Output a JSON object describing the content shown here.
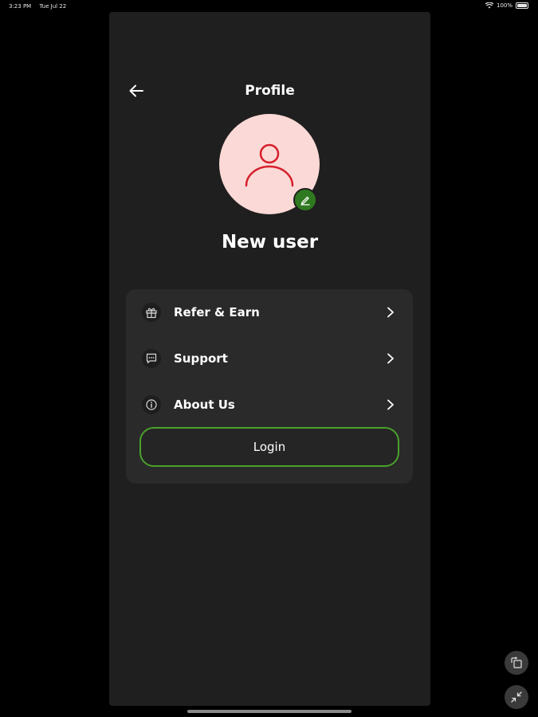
{
  "status_bar": {
    "time": "3:23 PM",
    "date": "Tue Jul 22",
    "battery": "100%"
  },
  "header": {
    "title": "Profile",
    "back_icon": "arrow-left-icon"
  },
  "profile": {
    "name": "New user",
    "avatar_icon": "user-icon",
    "edit_icon": "pencil-icon"
  },
  "menu": {
    "items": [
      {
        "label": "Refer & Earn",
        "icon": "gift-icon"
      },
      {
        "label": "Support",
        "icon": "chat-icon"
      },
      {
        "label": "About Us",
        "icon": "info-icon"
      }
    ],
    "login_label": "Login"
  },
  "colors": {
    "background": "#000000",
    "panel": "#1f1f1f",
    "card": "#2a2a2a",
    "avatar_bg": "#fbd9d6",
    "avatar_icon": "#d61f2c",
    "accent_green": "#4aa02c",
    "edit_badge": "#2f7a20"
  }
}
